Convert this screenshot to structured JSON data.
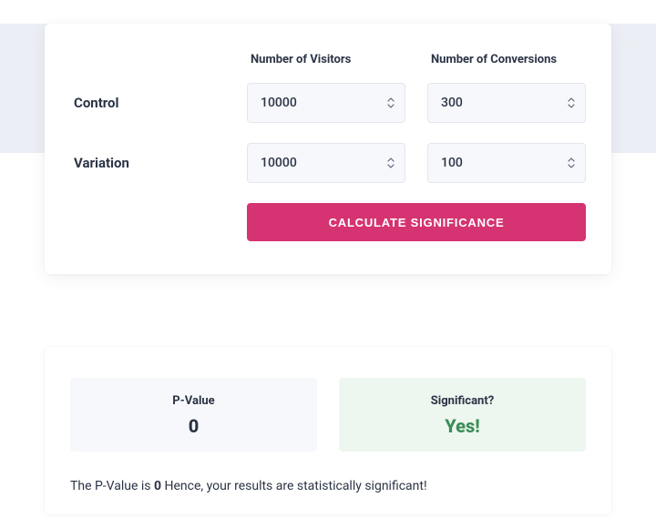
{
  "form": {
    "headers": {
      "visitors": "Number of Visitors",
      "conversions": "Number of Conversions"
    },
    "rows": {
      "control": {
        "label": "Control",
        "visitors": "10000",
        "conversions": "300"
      },
      "variation": {
        "label": "Variation",
        "visitors": "10000",
        "conversions": "100"
      }
    },
    "button": "CALCULATE SIGNIFICANCE"
  },
  "results": {
    "pvalue": {
      "label": "P-Value",
      "value": "0"
    },
    "significant": {
      "label": "Significant?",
      "value": "Yes!"
    },
    "explanation": {
      "prefix": "The P-Value is ",
      "pval": "0",
      "suffix": " Hence, your results are statistically significant!"
    }
  }
}
